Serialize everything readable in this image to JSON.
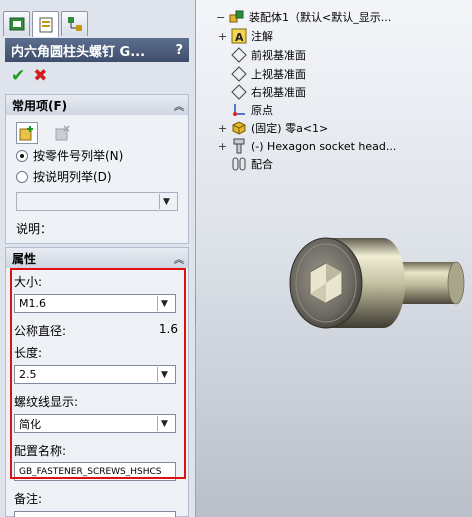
{
  "tabs": [
    {
      "name": "feature-manager-tab",
      "icon": "feature-manager-icon"
    },
    {
      "name": "property-manager-tab",
      "icon": "property-manager-icon"
    },
    {
      "name": "configuration-manager-tab",
      "icon": "configuration-manager-icon"
    }
  ],
  "property_manager": {
    "title": "内六角圆柱头螺钉 G...",
    "help": "?",
    "ok_icon": "✔",
    "cancel_icon": "✖"
  },
  "favorites_group": {
    "title": "常用项(F)",
    "radio_part_number": "按零件号列举(N)",
    "radio_description": "按说明列举(D)",
    "description_label": "说明："
  },
  "properties_group": {
    "title": "属性",
    "size_label": "大小:",
    "size_value": "M1.6",
    "nominal_diameter_label": "公称直径:",
    "nominal_diameter_value": "1.6",
    "length_label": "长度:",
    "length_value": "2.5",
    "thread_display_label": "螺纹线显示:",
    "thread_display_value": "简化",
    "config_name_label": "配置名称:",
    "config_name_value": "GB_FASTENER_SCREWS_HSHCS",
    "comment_label": "备注:"
  },
  "tree": {
    "root": "装配体1（默认<默认_显示...",
    "annotations": "注解",
    "front_plane": "前视基准面",
    "top_plane": "上视基准面",
    "right_plane": "右视基准面",
    "origin": "原点",
    "part": "(固定) 零a<1>",
    "screw": "(-) Hexagon socket head...",
    "mates": "配合"
  },
  "colors": {
    "title_bar": "#4a5a78",
    "highlight_box": "#e01010",
    "ok": "#1a9d1a",
    "cancel": "#d21d1d"
  }
}
